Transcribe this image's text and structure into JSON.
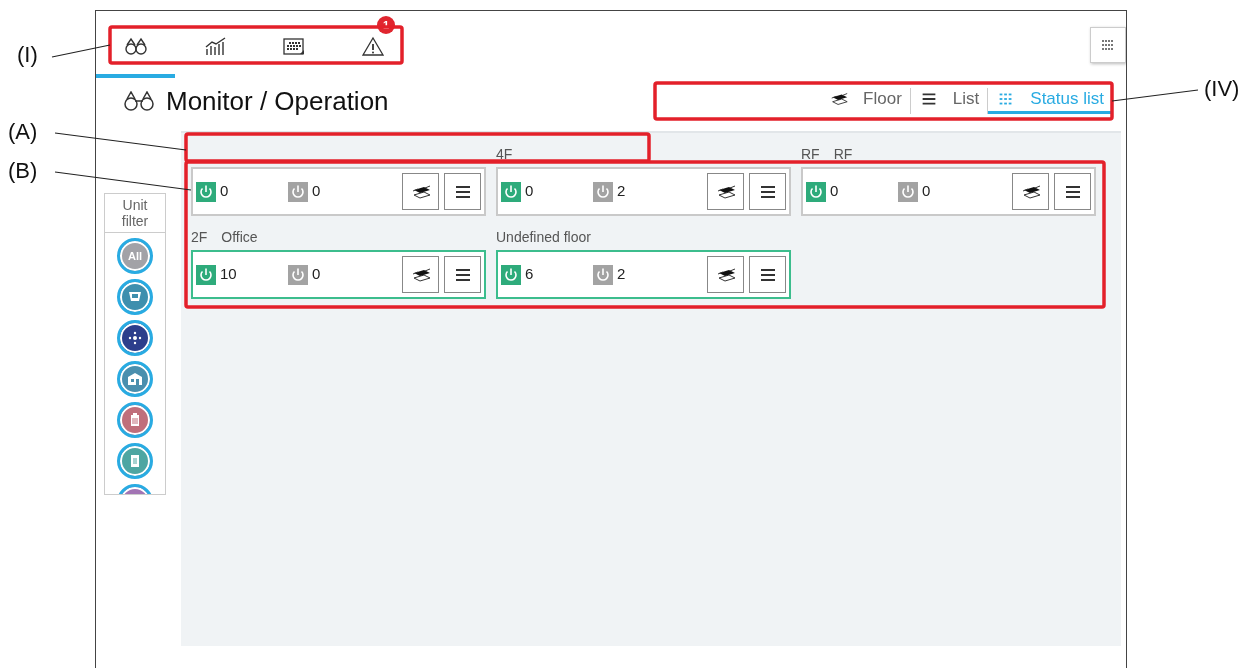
{
  "nav": {
    "items": [
      {
        "kind": "binoculars",
        "selected": true
      },
      {
        "kind": "chart",
        "selected": false
      },
      {
        "kind": "schedule",
        "selected": false
      },
      {
        "kind": "warning",
        "selected": false,
        "badge": "1"
      }
    ]
  },
  "title": "Monitor / Operation",
  "view_tabs": [
    {
      "kind": "floor",
      "label": "Floor",
      "selected": false
    },
    {
      "kind": "list",
      "label": "List",
      "selected": false
    },
    {
      "kind": "status",
      "label": "Status list",
      "selected": true
    }
  ],
  "unit_filter": {
    "title": "Unit filter",
    "items": [
      {
        "kind": "all",
        "label": "All",
        "color": "#a2a2a7"
      },
      {
        "kind": "indoor",
        "color": "#3e8fae"
      },
      {
        "kind": "vent",
        "color": "#2c3e8c"
      },
      {
        "kind": "building",
        "color": "#4a8fae"
      },
      {
        "kind": "battery",
        "color": "#c06f7b"
      },
      {
        "kind": "clipboard",
        "color": "#4ea6a2"
      },
      {
        "kind": "other",
        "color": "#a274b4"
      }
    ]
  },
  "groups": [
    {
      "on_count": "0",
      "off_count": "0",
      "highlighted": false
    },
    {
      "floor": "4F",
      "on_count": "0",
      "off_count": "2",
      "highlighted": false
    },
    {
      "floor": "RF",
      "name": "RF",
      "on_count": "0",
      "off_count": "0",
      "highlighted": false
    },
    {
      "floor": "2F",
      "name": "Office",
      "on_count": "10",
      "off_count": "0",
      "highlighted": true
    },
    {
      "floor": "Undefined floor",
      "on_count": "6",
      "off_count": "2",
      "highlighted": true
    }
  ],
  "callouts": [
    {
      "label": "(I)"
    },
    {
      "label": "(A)"
    },
    {
      "label": "(B)"
    },
    {
      "label": "(IV)"
    }
  ]
}
